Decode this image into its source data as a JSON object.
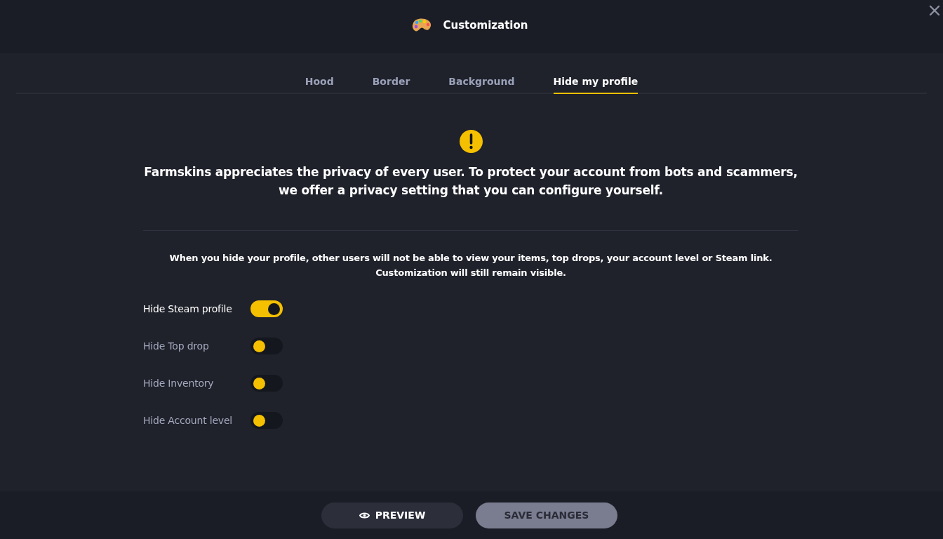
{
  "window": {
    "title": "Customization"
  },
  "tabs": [
    {
      "label": "Hood",
      "selected": false
    },
    {
      "label": "Border",
      "selected": false
    },
    {
      "label": "Background",
      "selected": false
    },
    {
      "label": "Hide my profile",
      "selected": true
    }
  ],
  "notice": {
    "heading": "Farmskins appreciates the privacy of every user. To protect your account from bots and scammers,\nwe offer a privacy setting that you can configure yourself.",
    "description": "When you hide your profile, other users will not be able to view your items, top drops, your account level or Steam link.\nCustomization will still remain visible."
  },
  "toggles": [
    {
      "label": "Hide Steam profile",
      "on": true
    },
    {
      "label": "Hide Top drop",
      "on": false
    },
    {
      "label": "Hide Inventory",
      "on": false
    },
    {
      "label": "Hide Account level",
      "on": false
    }
  ],
  "buttons": [
    {
      "label": "PREVIEW",
      "kind": "preview",
      "disabled": false
    },
    {
      "label": "SAVE CHANGES",
      "kind": "save",
      "disabled": true
    }
  ]
}
